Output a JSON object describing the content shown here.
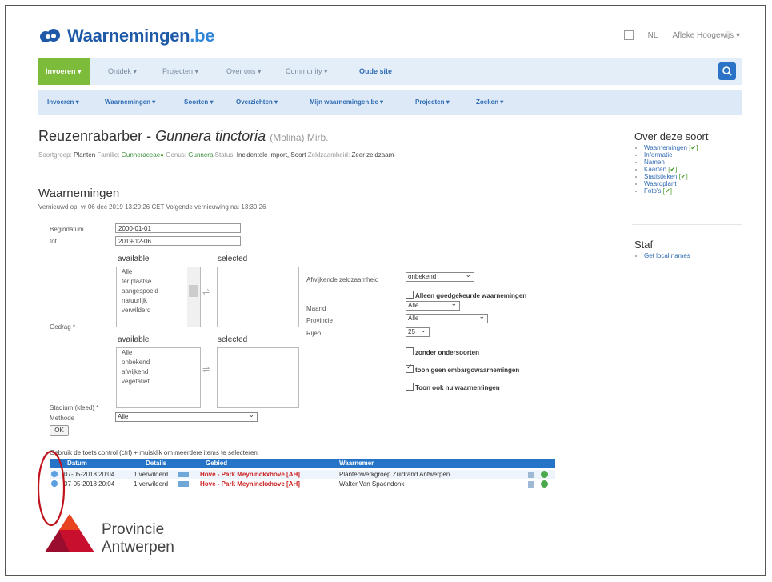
{
  "header": {
    "logo_main": "Waarnemingen",
    "logo_tld": ".be",
    "lang": "NL",
    "user": "Afleke Hoogewijs"
  },
  "nav1": {
    "items": [
      "Invoeren",
      "Ontdek",
      "Projecten",
      "Over ons",
      "Community",
      "Oude site"
    ]
  },
  "nav2": {
    "items": [
      "Invoeren",
      "Waarnemingen",
      "Soorten",
      "Overzichten",
      "Mijn waarnemingen.be",
      "Projecten",
      "Zoeken"
    ]
  },
  "species": {
    "common": "Reuzenrabarber",
    "dash": "-",
    "scientific": "Gunnera tinctoria",
    "author": "(Molina) Mirb.",
    "meta": {
      "group_label": "Soortgroep:",
      "group": "Planten",
      "family_label": "Familie:",
      "family": "Gunneraceae",
      "genus_label": "Genus:",
      "genus": "Gunnera",
      "status_label": "Status:",
      "status": "Incidentele import, Soort",
      "rarity_label": "Zeldzaamheid:",
      "rarity": "Zeer zeldzaam"
    }
  },
  "section": {
    "title": "Waarnemingen",
    "refresh": "Vernieuwd op: vr 06 dec 2019 13:29:26 CET Volgende vernieuwing na: 13:30:26"
  },
  "form": {
    "start_label": "Begindatum",
    "start_value": "2000-01-01",
    "end_label": "tot",
    "end_value": "2019-12-06",
    "available": "available",
    "selected": "selected",
    "gedrag_label": "Gedrag *",
    "list1": [
      "Alle",
      "ter plaatse",
      "aangespoeld",
      "natuurlijk",
      "verwilderd"
    ],
    "list2": [
      "Alle",
      "onbekend",
      "afwijkend",
      "vegetatief"
    ],
    "stadium_label": "Stadium (kleed) *",
    "methode_label": "Methode",
    "methode_value": "Alle",
    "ok": "OK",
    "afwijkende_label": "Afwijkende zeldzaamheid",
    "afwijkende_value": "onbekend",
    "alleen_goed": "Alleen goedgekeurde waarnemingen",
    "maand_label": "Maand",
    "maand_value": "Alle",
    "provincie_label": "Provincie",
    "provincie_value": "Alle",
    "rijen_label": "Rijen",
    "rijen_value": "25",
    "zonder": "zonder ondersoorten",
    "toon_geen": "toon geen embargowaarnemingen",
    "toon_ook": "Toon ook nulwaarnemingen",
    "hint": "Gebruik de toets control (ctrl) + muisklik om meerdere items te selecteren"
  },
  "table": {
    "headers": [
      "Datum",
      "Details",
      "Gebied",
      "Waarnemer"
    ],
    "rows": [
      {
        "date": "07-05-2018 20:04",
        "details": "1 verwilderd",
        "area": "Hove - Park Meyninckxhove [AH]",
        "observer": "Plantenwerkgroep Zuidrand Antwerpen"
      },
      {
        "date": "07-05-2018 20:04",
        "details": "1 verwilderd",
        "area": "Hove - Park Meyninckxhove [AH]",
        "observer": "Walter Van Spaendonk"
      }
    ]
  },
  "side": {
    "about_title": "Over deze soort",
    "about_items": [
      {
        "label": "Waarnemingen",
        "check": "[✔]"
      },
      {
        "label": "Informatie",
        "check": ""
      },
      {
        "label": "Namen",
        "check": ""
      },
      {
        "label": "Kaarten",
        "check": "[✔]"
      },
      {
        "label": "Statistieken",
        "check": "[✔]"
      },
      {
        "label": "Waardplant",
        "check": ""
      },
      {
        "label": "Foto's",
        "check": "[✔]"
      }
    ],
    "staf_title": "Staf",
    "staf_items": [
      "Get local names"
    ]
  },
  "footer_logo": {
    "line1": "Provincie",
    "line2": "Antwerpen"
  },
  "colors": {
    "brand_blue": "#1e5aa8",
    "nav_green": "#7dbb3a",
    "table_blue": "#2574c8",
    "area_red": "#cc2222",
    "annot_red": "#c0141c",
    "prov_red": "#c8102e"
  }
}
